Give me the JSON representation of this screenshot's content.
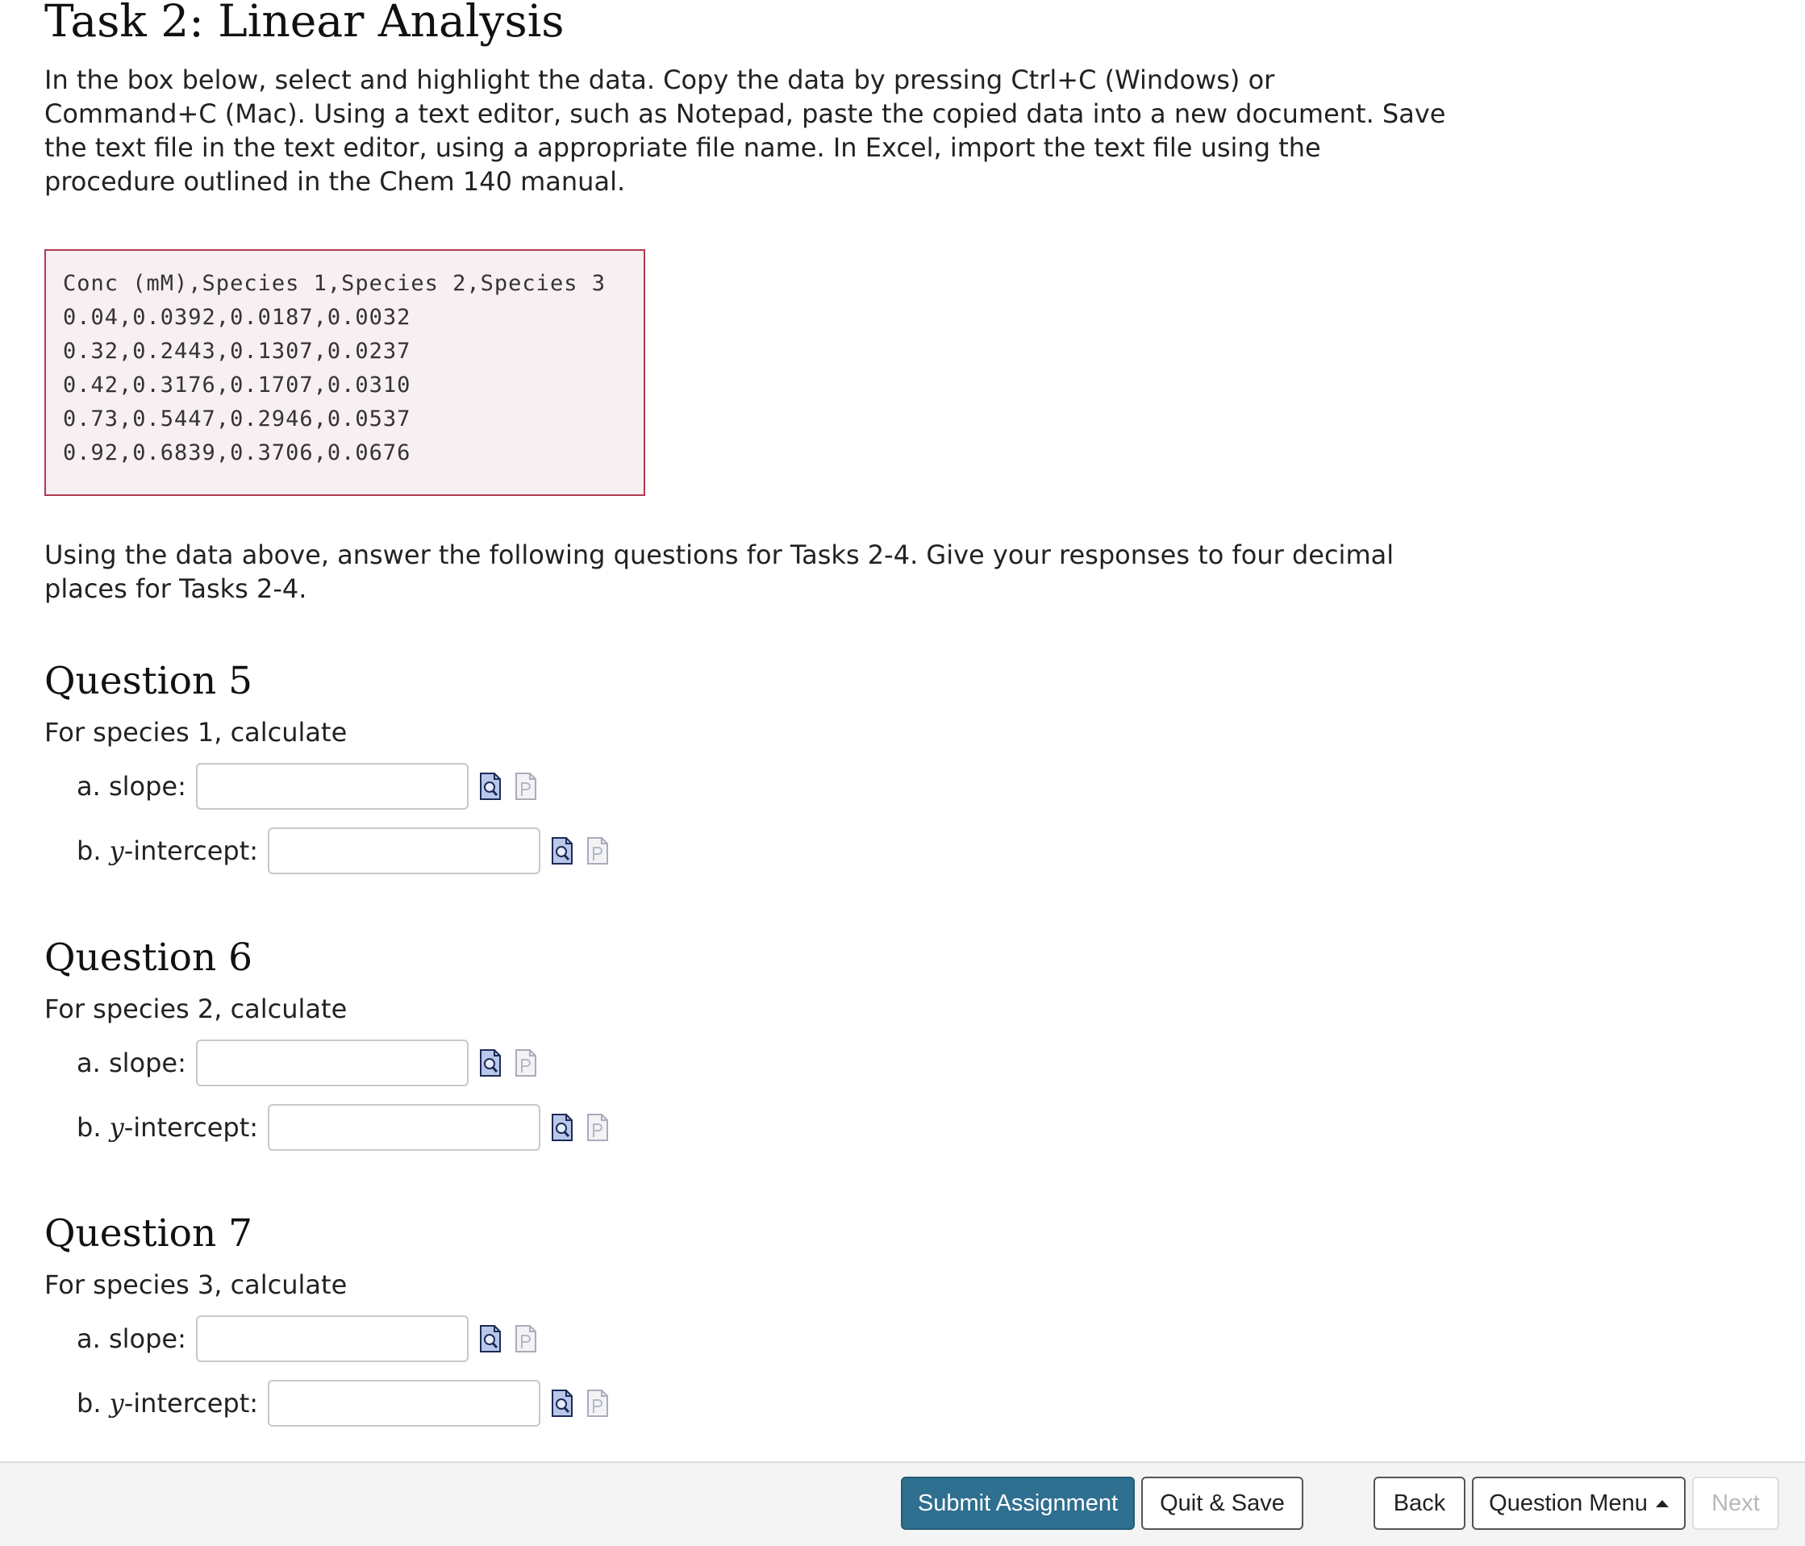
{
  "task": {
    "title": "Task 2: Linear Analysis",
    "intro": "In the box below, select and highlight the data. Copy the data by pressing Ctrl+C (Windows) or Command+C (Mac). Using a text editor, such as Notepad, paste the copied data into a new document. Save the text file in the text editor, using a appropriate file name. In Excel, import the text file using the procedure outlined in the Chem 140 manual.",
    "data_lines": [
      "Conc (mM),Species 1,Species 2,Species 3",
      "0.04,0.0392,0.0187,0.0032",
      "0.32,0.2443,0.1307,0.0237",
      "0.42,0.3176,0.1707,0.0310",
      "0.73,0.5447,0.2946,0.0537",
      "0.92,0.6839,0.3706,0.0676"
    ],
    "instructions": "Using the data above, answer the following questions for Tasks 2-4. Give your responses to four decimal places for Tasks 2-4."
  },
  "questions": [
    {
      "title": "Question 5",
      "prompt": "For species 1, calculate",
      "slope_label": "a. slope:",
      "intercept_prefix": "b. ",
      "intercept_var": "y",
      "intercept_suffix": "-intercept:",
      "slope_value": "",
      "intercept_value": ""
    },
    {
      "title": "Question 6",
      "prompt": "For species 2, calculate",
      "slope_label": "a. slope:",
      "intercept_prefix": "b. ",
      "intercept_var": "y",
      "intercept_suffix": "-intercept:",
      "slope_value": "",
      "intercept_value": ""
    },
    {
      "title": "Question 7",
      "prompt": "For species 3, calculate",
      "slope_label": "a. slope:",
      "intercept_prefix": "b. ",
      "intercept_var": "y",
      "intercept_suffix": "-intercept:",
      "slope_value": "",
      "intercept_value": ""
    }
  ],
  "icons": {
    "preview": "document-magnifier-icon",
    "page": "document-page-icon"
  },
  "footer": {
    "submit_label": "Submit Assignment",
    "quit_label": "Quit & Save",
    "back_label": "Back",
    "menu_label": "Question Menu",
    "next_label": "Next"
  },
  "colors": {
    "primary_button": "#2f6f8f",
    "data_box_border": "#b13a54",
    "data_box_background": "#f7eff1"
  }
}
